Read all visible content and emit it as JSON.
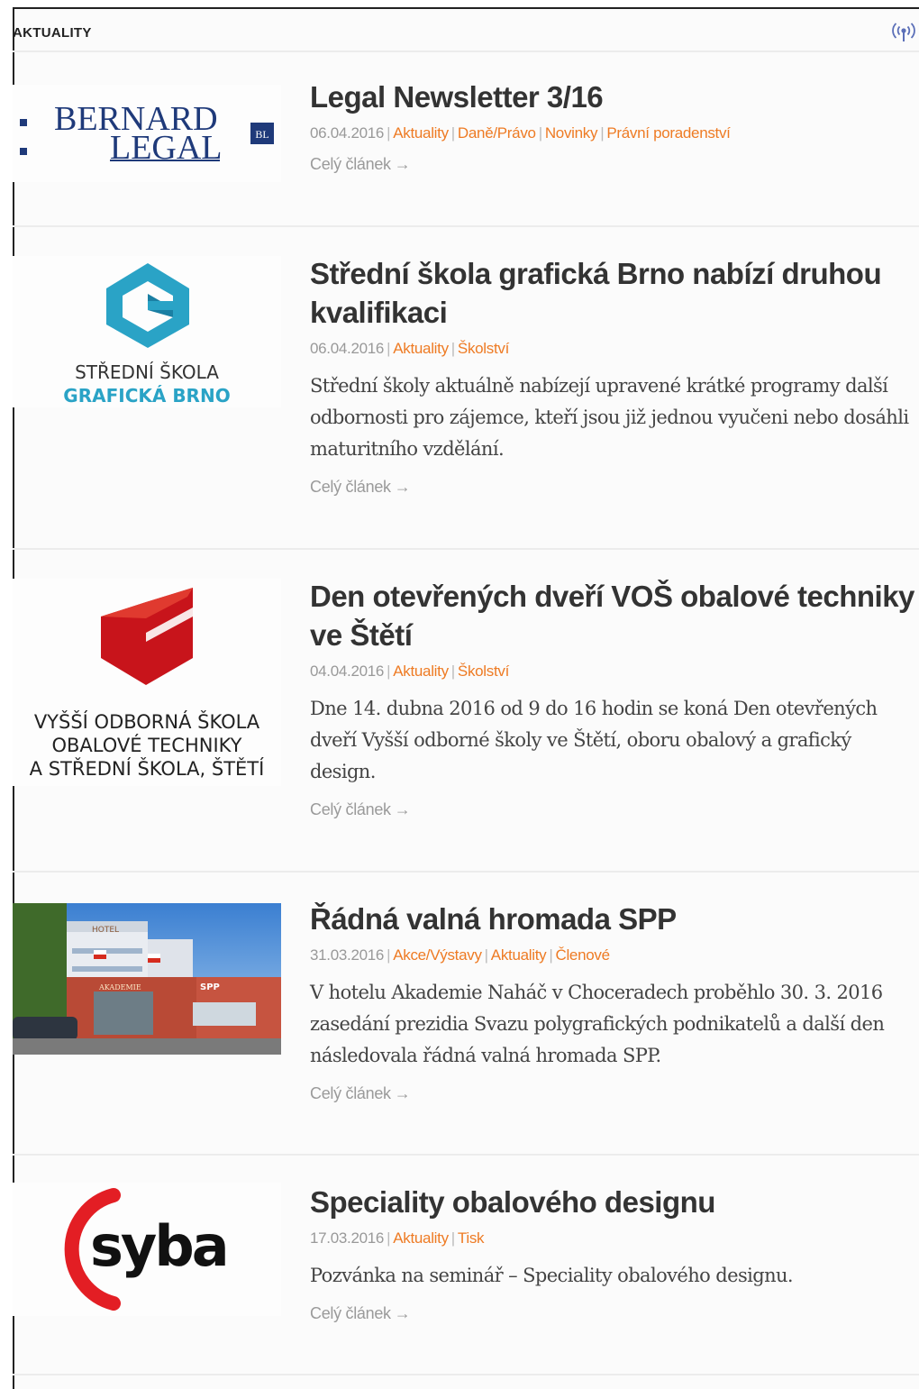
{
  "section": {
    "title": "AKTUALITY",
    "rss_icon": "rss-icon"
  },
  "articles": [
    {
      "title": "Legal Newsletter 3/16",
      "date": "06.04.2016",
      "categories": [
        "Aktuality",
        "Daně/Právo",
        "Novinky",
        "Právní poradenství"
      ],
      "excerpt": "",
      "more_label": "Celý článek",
      "thumb": {
        "brand_line1": "BERNARD",
        "brand_line2": "LEGAL",
        "badge": "BL"
      }
    },
    {
      "title": "Střední škola grafická Brno nabízí druhou kvalifikaci",
      "date": "06.04.2016",
      "categories": [
        "Aktuality",
        "Školství"
      ],
      "excerpt": "Střední školy aktuálně nabízejí upravené krátké programy další odbornosti pro zájemce, kteří jsou již jednou vyučeni nebo dosáhli maturitního vzdělání.",
      "more_label": "Celý článek",
      "thumb": {
        "line1": "STŘEDNÍ ŠKOLA",
        "line2": "GRAFICKÁ BRNO"
      }
    },
    {
      "title": "Den otevřených dveří VOŠ obalové techniky ve Štětí",
      "date": "04.04.2016",
      "categories": [
        "Aktuality",
        "Školství"
      ],
      "excerpt": "Dne 14. dubna 2016 od 9 do 16 hodin se koná Den otevřených dveří Vyšší odborné školy ve Štětí, oboru obalový a grafický design.",
      "more_label": "Celý článek",
      "thumb": {
        "line1": "VYŠŠÍ ODBORNÁ ŠKOLA",
        "line2": "OBALOVÉ TECHNIKY",
        "line3": "A STŘEDNÍ ŠKOLA, ŠTĚTÍ"
      }
    },
    {
      "title": "Řádná valná hromada SPP",
      "date": "31.03.2016",
      "categories": [
        "Akce/Výstavy",
        "Aktuality",
        "Členové"
      ],
      "excerpt": "V hotelu Akademie Naháč v Choceradech proběhlo 30. 3. 2016 zasedání prezidia Svazu polygrafických podnikatelů a další den následovala řádná valná hromada SPP.",
      "more_label": "Celý článek",
      "thumb": {
        "sign_hotel": "HOTEL",
        "sign_name": "AKADEMIE",
        "sign_spp": "SPP"
      }
    },
    {
      "title": "Speciality obalového designu",
      "date": "17.03.2016",
      "categories": [
        "Aktuality",
        "Tisk"
      ],
      "excerpt": "Pozvánka na seminář – Speciality obalového designu.",
      "more_label": "Celý článek",
      "thumb": {
        "brand": "syba"
      }
    }
  ],
  "colors": {
    "accent": "#ee7b24",
    "meta": "#999999",
    "title": "#333333",
    "divider": "#ececec"
  }
}
